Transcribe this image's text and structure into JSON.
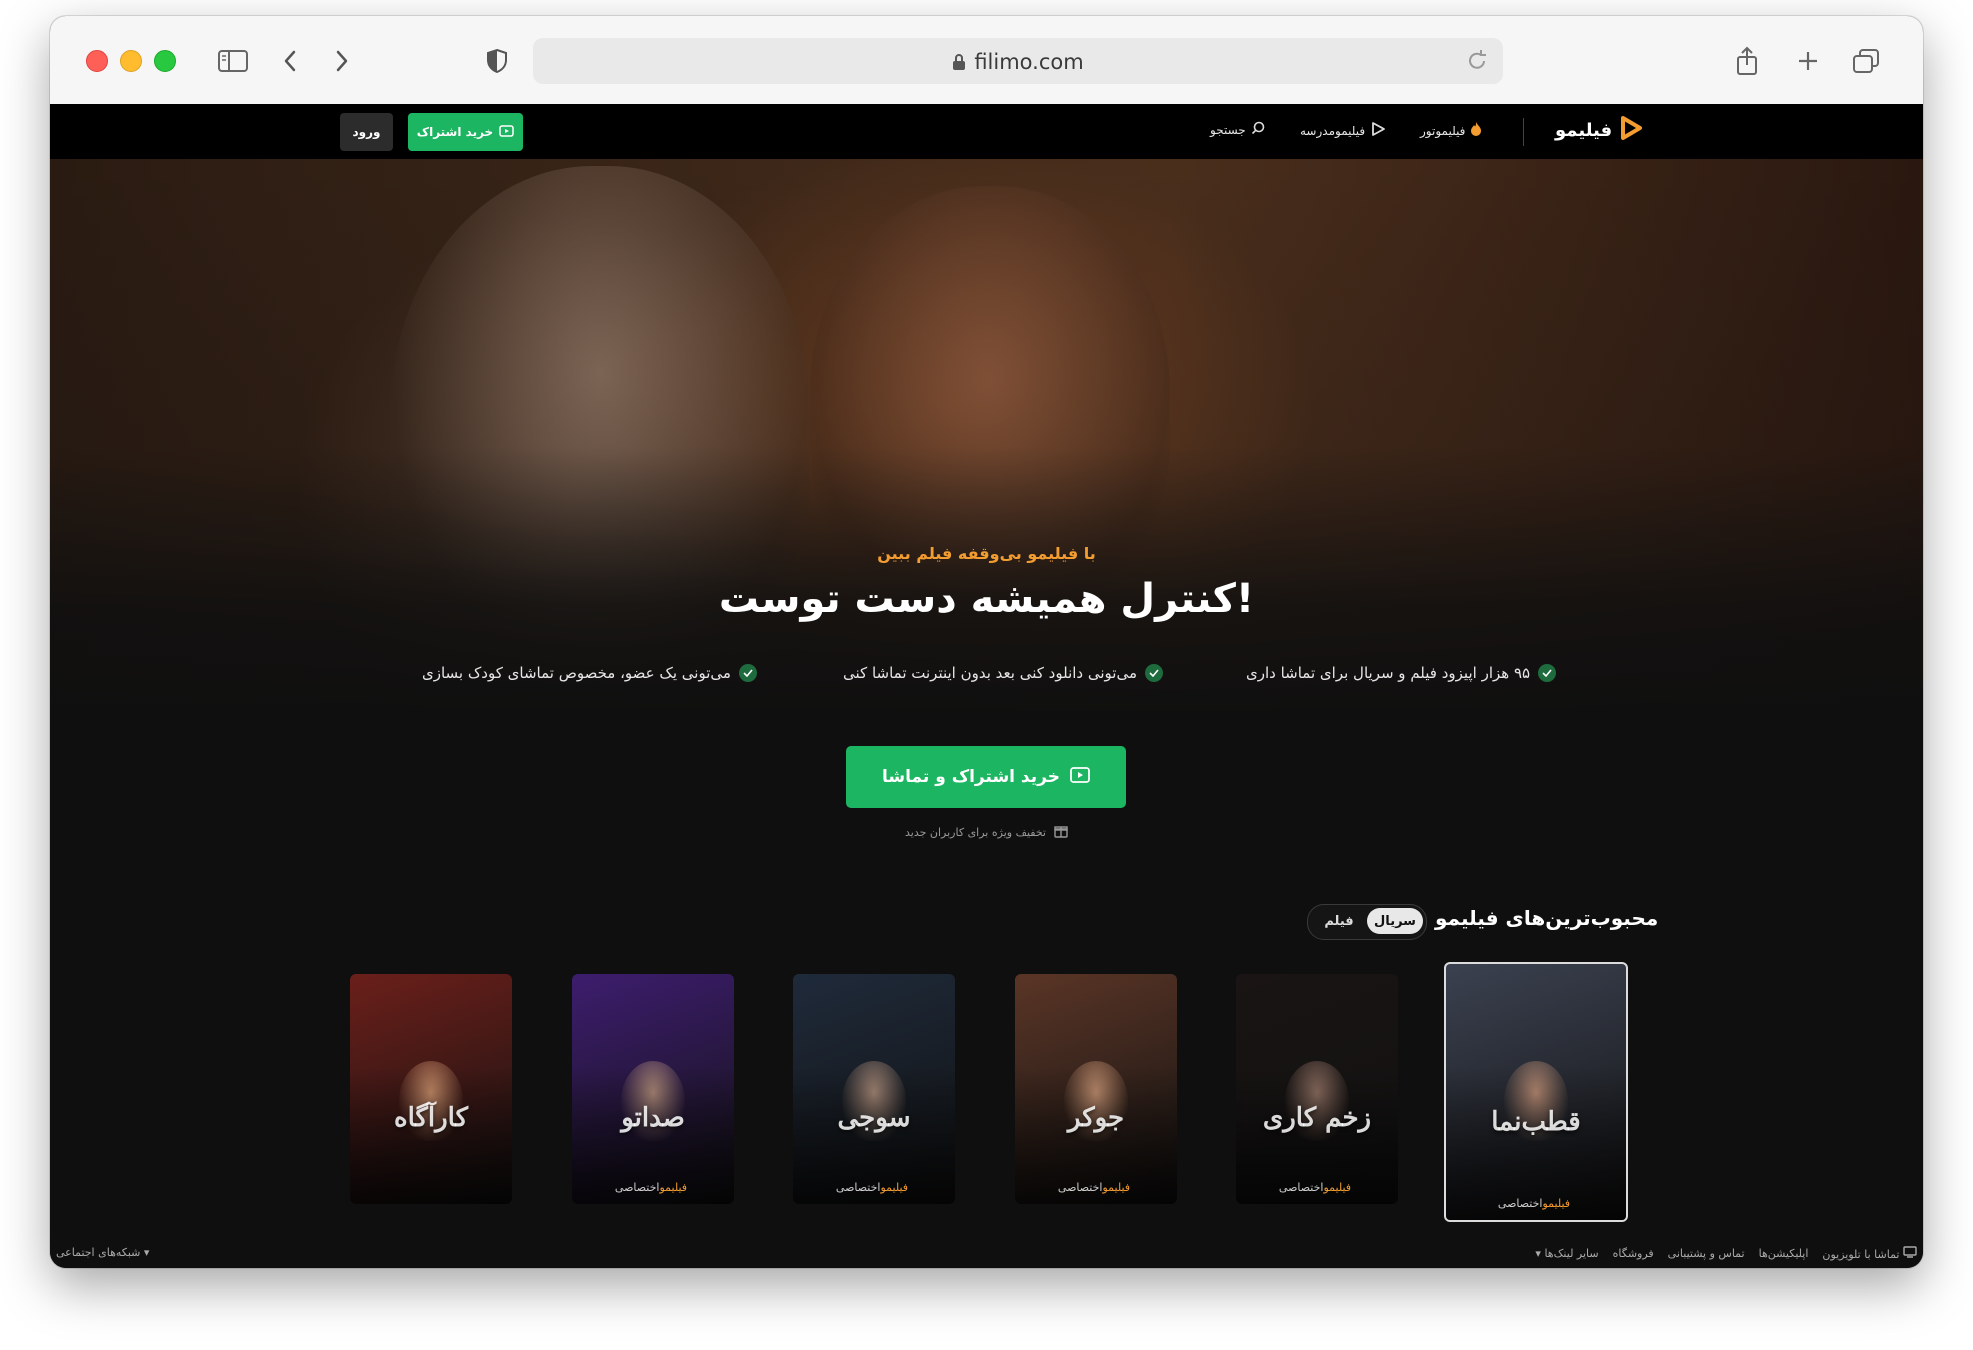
{
  "browser": {
    "url": "filimo.com"
  },
  "header": {
    "logo_text": "فیلیمو",
    "nav": [
      {
        "label": "فیلیموتور",
        "icon": "fire-icon"
      },
      {
        "label": "فیلیمومدرسه",
        "icon": "school-icon"
      },
      {
        "label": "جستجو",
        "icon": "search-icon"
      }
    ],
    "buy_label": "خرید اشتراک",
    "login_label": "ورود"
  },
  "hero": {
    "tagline": "با فیلیمو بی‌وقفه فیلم ببین",
    "title": "کنترل همیشه دست توست!",
    "features": [
      "۹۵ هزار اپیزود فیلم و سریال برای تماشا داری",
      "می‌تونی دانلود کنی بعد بدون اینترنت تماشا کنی",
      "می‌تونی یک عضو، مخصوص تماشای کودک بسازی"
    ],
    "cta_label": "خرید اشتراک و تماشا",
    "discount_text": "تخفیف ویژه برای کاربران جدید"
  },
  "popular": {
    "title": "محبوب‌ترین‌های فیلیمو",
    "tabs": [
      "سریال",
      "فیلم"
    ],
    "active_tab": "سریال",
    "exclusive_label": "اختصاصی",
    "brand_label": "فیلیمو",
    "posters": [
      {
        "title": "قطب‌نما",
        "exclusive": true,
        "selected": true,
        "bg": "#3b4150",
        "face": "#b98c74"
      },
      {
        "title": "زخم کاری",
        "exclusive": true,
        "selected": false,
        "bg": "#1a1414",
        "face": "#8f7062"
      },
      {
        "title": "جوکر",
        "exclusive": true,
        "selected": false,
        "bg": "#5a3526",
        "face": "#c59272"
      },
      {
        "title": "سوجی",
        "exclusive": true,
        "selected": false,
        "bg": "#1f2a3a",
        "face": "#a98a78"
      },
      {
        "title": "صداتو",
        "exclusive": true,
        "selected": false,
        "bg": "#3d1d6e",
        "face": "#b08c7a"
      },
      {
        "title": "کارآگاه",
        "exclusive": false,
        "selected": false,
        "bg": "#6b1f1a",
        "face": "#c98f6a"
      }
    ]
  },
  "footer": {
    "social_label": "شبکه‌های اجتماعی",
    "links": [
      "تماشا با تلویزیون",
      "اپلیکیشن‌ها",
      "تماس و پشتیبانی",
      "فروشگاه",
      "سایر لینک‌ها"
    ]
  },
  "colors": {
    "accent_green": "#1cb561",
    "accent_orange": "#f39c2f",
    "header_bg": "#000000",
    "page_bg": "#0f0f0f"
  }
}
